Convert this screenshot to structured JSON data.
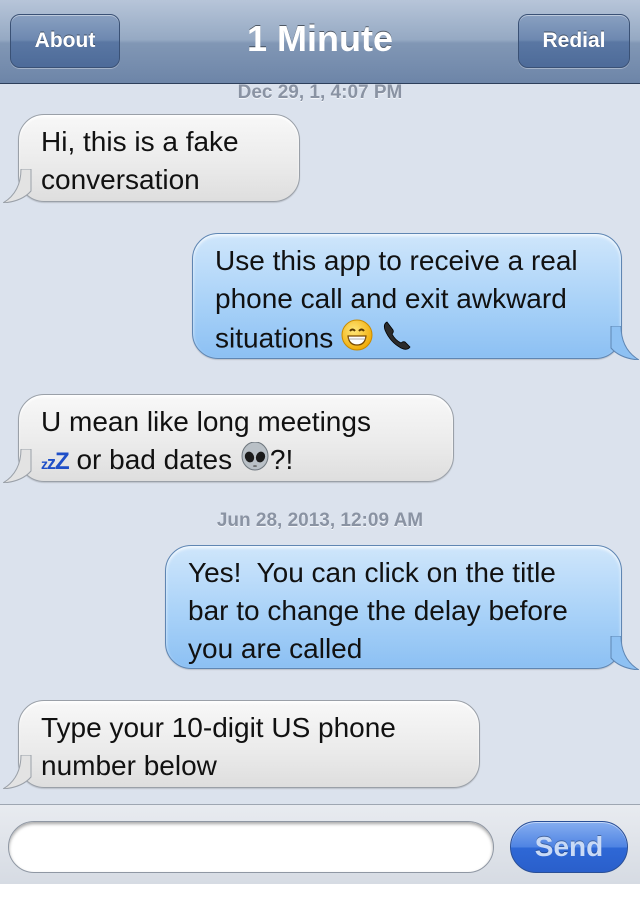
{
  "navbar": {
    "about_label": "About",
    "title": "1 Minute",
    "redial_label": "Redial"
  },
  "timestamps": [
    "Dec 29, 1, 4:07 PM",
    "Jun 28, 2013, 12:09 AM"
  ],
  "messages": [
    {
      "direction": "incoming",
      "text": "Hi, this is a fake conversation"
    },
    {
      "direction": "outgoing",
      "text": "Use this app to receive a real phone call and exit awkward situations",
      "emojis": [
        "grinning-face-icon",
        "telephone-receiver-icon"
      ]
    },
    {
      "direction": "incoming",
      "text_before": "U mean like long meetings",
      "zzz": "zzZ",
      "text_after": "or bad dates",
      "emoji": "alien-icon",
      "suffix": "?!"
    },
    {
      "direction": "outgoing",
      "text": "Yes!  You can click on the title bar to change the delay before you are called"
    },
    {
      "direction": "incoming",
      "text": "Type your 10-digit US phone number below"
    }
  ],
  "composer": {
    "input_value": "",
    "send_label": "Send"
  },
  "colors": {
    "incoming_bubble": "#eaeaea",
    "outgoing_bubble": "#a9d2f8",
    "background": "#dbe2ed",
    "navbar": "#8197b5",
    "send_button": "#4f84e3"
  }
}
